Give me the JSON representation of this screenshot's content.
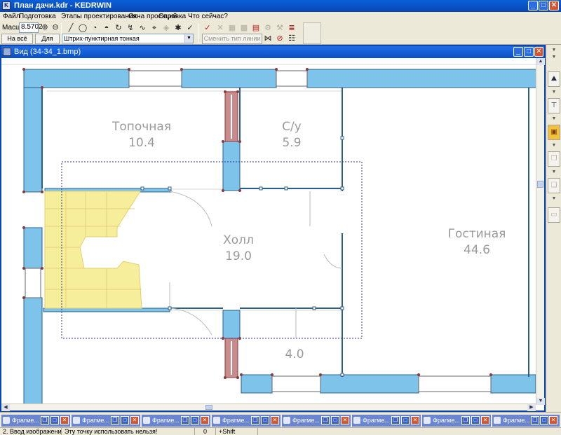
{
  "window": {
    "title": "План дачи.kdr - KEDRWIN",
    "minimize_glyph": "_",
    "maximize_glyph": "□",
    "close_glyph": "✕"
  },
  "menu": {
    "items": [
      {
        "label": "Файл"
      },
      {
        "label": "Подготовка"
      },
      {
        "label": "Этапы проектирования"
      },
      {
        "label": "Окна проекций"
      },
      {
        "label": "Справка"
      },
      {
        "label": "Что сейчас?"
      }
    ]
  },
  "toolbar": {
    "scale_label": "Масшт",
    "scale_value": "8.5702",
    "zoom_in_glyph": "⊕",
    "zoom_out_glyph": "⊖",
    "fit_all_label": "На всё окно",
    "for_all_label": "Для всех",
    "line_type_value": "Штрих-пунктирная тонкая",
    "change_line_type_label": "Сменить тип линии",
    "tools": [
      {
        "name": "line-tool-icon",
        "glyph": "╱"
      },
      {
        "name": "circle-tool-icon",
        "glyph": "◯"
      },
      {
        "name": "arc-tool-icon",
        "glyph": "◔"
      },
      {
        "name": "arc-3pt-tool-icon",
        "glyph": "◓"
      },
      {
        "name": "rotate-tool-icon",
        "glyph": "↻"
      },
      {
        "name": "fillet-tool-icon",
        "glyph": "↯"
      },
      {
        "name": "curve-tool-icon",
        "glyph": "∿"
      },
      {
        "name": "disabled-tool-icon",
        "glyph": "⌖"
      },
      {
        "name": "point-snap-icon",
        "glyph": "◈"
      },
      {
        "name": "break-tool-icon",
        "glyph": "✱"
      },
      {
        "name": "check-red-icon",
        "glyph": "✓"
      },
      {
        "name": "cross-disabled-icon",
        "glyph": "✕"
      },
      {
        "name": "grid-disabled-icon",
        "glyph": "▦"
      },
      {
        "name": "pattern-disabled-icon",
        "glyph": "▩"
      },
      {
        "name": "layers-red-icon",
        "glyph": "▤"
      },
      {
        "name": "gear-disabled-icon",
        "glyph": "⚙"
      },
      {
        "name": "wrench-disabled-icon",
        "glyph": "⚒"
      },
      {
        "name": "stack-red-icon",
        "glyph": "≣"
      },
      {
        "name": "mirror-icon",
        "glyph": "⋈"
      },
      {
        "name": "erase-red-icon",
        "glyph": "⊘"
      },
      {
        "name": "properties-icon",
        "glyph": "☷"
      }
    ]
  },
  "document": {
    "title": "Вид (34-34_1.bmp)"
  },
  "plan": {
    "rooms": [
      {
        "name": "Топочная",
        "area": "10.4"
      },
      {
        "name": "С/у",
        "area": "5.9"
      },
      {
        "name": "Холл",
        "area": "19.0"
      },
      {
        "name": "Гостиная",
        "area": "44.6"
      },
      {
        "name": "",
        "area": "4.0"
      }
    ]
  },
  "right_panel": {
    "buttons": [
      {
        "name": "wall-view-icon",
        "glyph": "⛰"
      },
      {
        "name": "section-tool-icon",
        "glyph": "⊤"
      },
      {
        "name": "palette-tool-icon",
        "glyph": "▣"
      },
      {
        "name": "copy-disabled-icon",
        "glyph": "❐"
      },
      {
        "name": "paste-disabled-icon",
        "glyph": "❏"
      },
      {
        "name": "layer-disabled-icon",
        "glyph": "▭"
      }
    ]
  },
  "fragments": [
    {
      "label": "Фрагме..."
    },
    {
      "label": "Фрагме..."
    },
    {
      "label": "Фрагме..."
    },
    {
      "label": "Фрагме..."
    },
    {
      "label": "Фрагме..."
    },
    {
      "label": "Фрагме..."
    },
    {
      "label": "Фрагме..."
    },
    {
      "label": "Фрагме..."
    }
  ],
  "status": {
    "stage": "2. Ввод изображения",
    "message": "Эту точку использовать нельзя!",
    "value": "0",
    "modifier": "+Shift"
  },
  "colors": {
    "wall_fill": "#7ec3ea",
    "stair_fill": "#f7ee9c",
    "stair_wall": "#b8706e",
    "title_blue": "#0847b5",
    "node": "#8a3a3a"
  }
}
